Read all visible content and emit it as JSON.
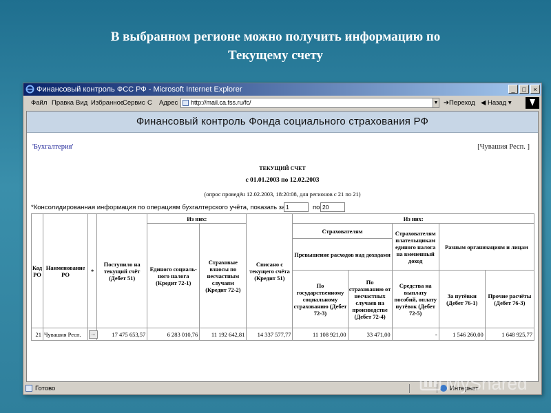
{
  "slide": {
    "title_line1": "В выбранном регионе можно получить информацию по",
    "title_line2": "Текущему счету"
  },
  "browser": {
    "window_title": "Финансовый контроль ФСС РФ - Microsoft Internet Explorer",
    "menu": [
      "Файл",
      "Правка",
      "Вид",
      "Избранное",
      "Сервис",
      "С"
    ],
    "address_label": "Адрес",
    "address_value": "http://mail.ca.fss.ru/fc/",
    "go_label": "Переход",
    "back_label": "Назад",
    "status_text": "Готово",
    "zone_text": "Интернет"
  },
  "page": {
    "banner": "Финансовый контроль Фонда социального страхования РФ",
    "left_link": "'Бухгалтерия'",
    "right_link": "[Чувашия Респ. ]",
    "report_title": "ТЕКУЩИЙ СЧЕТ",
    "period": "с 01.01.2003 по 12.02.2003",
    "survey_note": "(опрос проведён 12.02.2003, 18:20:08, для регионов с 21 по 21)",
    "filter_text": "*Консолидированная информация по операциям бухгалтерского учёта,  показать записи с",
    "filter_to": "по",
    "filter_from_value": "1",
    "filter_to_value": "20"
  },
  "table": {
    "h_code": "Код РО",
    "h_name": "Наименование РО",
    "h_star": "*",
    "h_received": "Поступило на текущий счёт (Дебет 51)",
    "h_of_them1": "Из них:",
    "h_ens": "Единого социаль-ного налога (Кредит 72-1)",
    "h_ins": "Страховые взносы по несчастным случаям (Кредит 72-2)",
    "h_written": "Списано с текущего счёта (Кредит 51)",
    "h_of_them2": "Из них:",
    "h_insurers": "Страхователям",
    "h_payers": "Страхователям плательщикам единого налога на вмененный доход",
    "h_various": "Разным организациям и лицам",
    "h_excess": "Превышение расходов над доходами",
    "h_state": "По государственному социальному страхованию (Дебет 72-3)",
    "h_accident": "По страхованию от несчастных случаев на производстве (Дебет 72-4)",
    "h_funds": "Средства на выплату пособий, оплату путёвок (Дебет 72-5)",
    "h_vouchers": "За путёвки (Дебет 76-1)",
    "h_other": "Прочие расчёты (Дебет 76-3)",
    "row": {
      "code": "21",
      "name": "Чувашия Респ.",
      "btn": "...",
      "received": "17 475 653,57",
      "ens": "6 283 010,76",
      "ins": "11 192 642,81",
      "written": "14 337 577,77",
      "state": "11 108 921,00",
      "accident": "33 471,00",
      "funds": "-",
      "vouchers": "1 546 260,00",
      "other": "1 648 925,77"
    }
  },
  "watermark": {
    "text": "MyShared"
  },
  "colors": {
    "slide_bg": "#2f7f9c",
    "titlebar_start": "#0a246a",
    "titlebar_end": "#a6caf0",
    "banner_bg": "#c7d6e6",
    "link_color": "#22289a"
  }
}
